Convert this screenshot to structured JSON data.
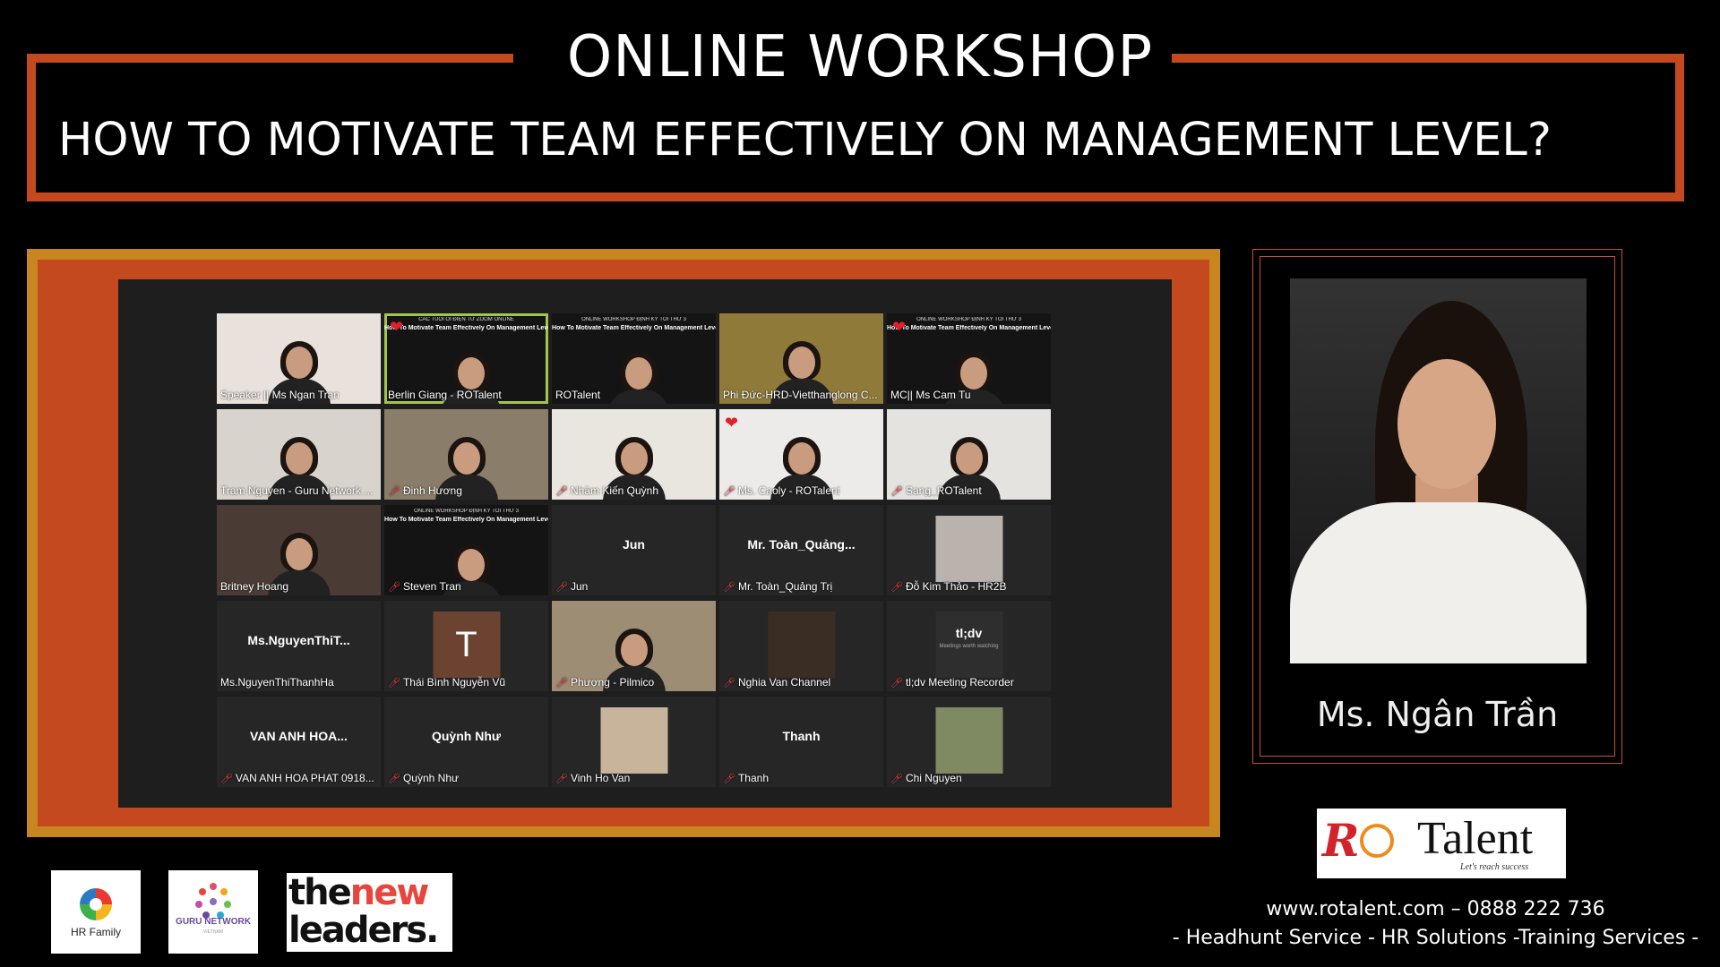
{
  "header": {
    "title": "ONLINE WORKSHOP",
    "subtitle": "HOW TO MOTIVATE TEAM EFFECTIVELY ON MANAGEMENT LEVEL?"
  },
  "gallery": {
    "tiles": [
      {
        "name": "Speaker || Ms Ngan Tran",
        "muted": false,
        "kind": "video",
        "bg": "#e9e2dc"
      },
      {
        "name": "Berlin Giang - ROTalent",
        "muted": false,
        "kind": "slide",
        "active": true,
        "heart": true,
        "slide_title": "CÁC TUỔI ỔI ĐIỆN TỬ ZOOM ONLINE",
        "slide_sub": "How To Motivate Team Effectively On Management Level?",
        "bg": "#141414"
      },
      {
        "name": "ROTalent",
        "muted": false,
        "kind": "slide",
        "slide_title": "ONLINE WORKSHOP ĐỊNH KỲ TỐI THỨ 3",
        "slide_sub": "How To Motivate Team Effectively On Management Level?",
        "bg": "#141414"
      },
      {
        "name": "Phi Đức-HRD-Vietthanglong C...",
        "muted": false,
        "kind": "video",
        "bg": "#8f7a3a"
      },
      {
        "name": "MC|| Ms Cam Tu",
        "muted": false,
        "kind": "slide",
        "heart": true,
        "slide_title": "ONLINE WORKSHOP ĐỊNH KỲ TỐI THỨ 3",
        "slide_sub": "How To Motivate Team Effectively On Management Level?",
        "bg": "#141414"
      },
      {
        "name": "Tram Nguyen - Guru Network ...",
        "muted": false,
        "kind": "video",
        "bg": "#d8d3cc"
      },
      {
        "name": "Đinh Hương",
        "muted": true,
        "kind": "video",
        "bg": "#8a7d6a"
      },
      {
        "name": "Nhâm Kiến Quỳnh",
        "muted": true,
        "kind": "video",
        "bg": "#e9e5df"
      },
      {
        "name": "Ms. Caoly - ROTalent",
        "muted": true,
        "kind": "video",
        "heart": true,
        "bg": "#ecebe9"
      },
      {
        "name": "Sang_ROTalent",
        "muted": true,
        "kind": "video",
        "bg": "#e5e3e0"
      },
      {
        "name": "Britney Hoang",
        "muted": false,
        "kind": "video",
        "bg": "#4a3c34"
      },
      {
        "name": "Steven Tran",
        "muted": true,
        "kind": "slide",
        "slide_title": "ONLINE WORKSHOP ĐỊNH KỲ TỐI THỨ 3",
        "slide_sub": "How To Motivate Team Effectively On Management Level?",
        "bg": "#141414"
      },
      {
        "name": "Jun",
        "muted": true,
        "kind": "text",
        "center": "Jun"
      },
      {
        "name": "Mr. Toàn_Quảng Trị",
        "muted": true,
        "kind": "text",
        "center": "Mr.  Toàn_Quảng..."
      },
      {
        "name": "Đỗ Kim Thảo - HR2B",
        "muted": true,
        "kind": "thumb",
        "thumb_bg": "#b9b2ad"
      },
      {
        "name": "Ms.NguyenThiThanhHa",
        "muted": false,
        "kind": "text",
        "center": "Ms.NguyenThiT..."
      },
      {
        "name": "Thái Bình Nguyễn Vũ",
        "muted": true,
        "kind": "avatar",
        "avatar_letter": "T"
      },
      {
        "name": "Phượng - Pilmico",
        "muted": true,
        "kind": "video",
        "bg": "#9d8d74"
      },
      {
        "name": "Nghia Van Channel",
        "muted": true,
        "kind": "thumb",
        "thumb_bg": "#3a2d23"
      },
      {
        "name": "tl;dv Meeting Recorder",
        "muted": true,
        "kind": "tldv",
        "tldv_title": "tl;dv",
        "tldv_sub": "Meetings worth watching"
      },
      {
        "name": "VAN ANH HOA PHAT 0918...",
        "muted": true,
        "kind": "text",
        "center": "VAN ANH HOA..."
      },
      {
        "name": "Quỳnh Như",
        "muted": true,
        "kind": "text",
        "center": "Quỳnh Như"
      },
      {
        "name": "Vinh Ho Van",
        "muted": true,
        "kind": "thumb",
        "thumb_bg": "#c8b49a"
      },
      {
        "name": "Thanh",
        "muted": true,
        "kind": "text",
        "center": "Thanh"
      },
      {
        "name": "Chi Nguyen",
        "muted": true,
        "kind": "thumb",
        "thumb_bg": "#7f8a63"
      }
    ]
  },
  "speaker": {
    "name": "Ms. Ngân Trần"
  },
  "brand": {
    "logo_text": "Talent",
    "tagline": "Let's reach success",
    "contact_line": "www.rotalent.com – 0888 222 736",
    "services_line": "- Headhunt Service - HR Solutions -Training Services -"
  },
  "partners": {
    "hr_family": "HR Family",
    "guru": "GURU NETWORK",
    "guru_sub": "VIETNAM",
    "tnl_1a": "the",
    "tnl_1b": "new",
    "tnl_2": "leaders."
  },
  "colors": {
    "frame_orange": "#c5491f",
    "frame_gold": "#c7861f",
    "brand_red": "#d2232a"
  }
}
